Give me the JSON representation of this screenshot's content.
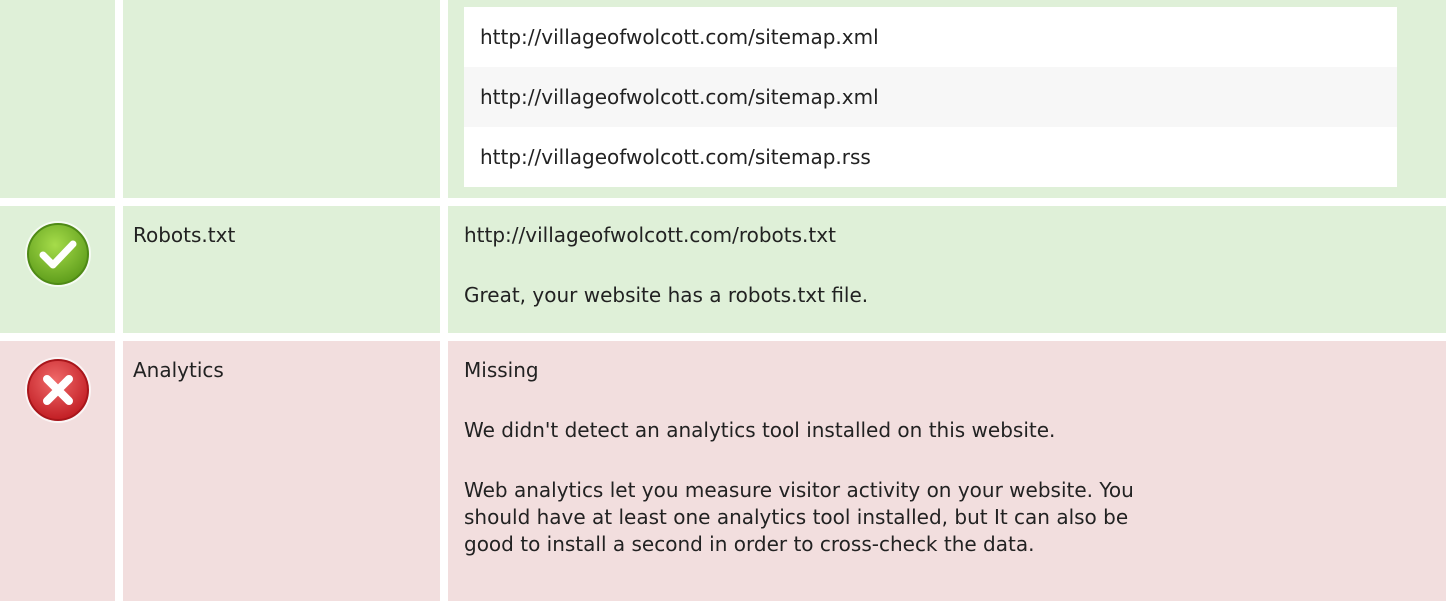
{
  "sitemap": {
    "urls": [
      "http://villageofwolcott.com/sitemap.xml",
      "http://villageofwolcott.com/sitemap.xml",
      "http://villageofwolcott.com/sitemap.rss"
    ]
  },
  "robots": {
    "status_icon": "check-icon",
    "status_color": "#7ab82e",
    "label": "Robots.txt",
    "url": "http://villageofwolcott.com/robots.txt",
    "message": "Great, your website has a robots.txt file."
  },
  "analytics": {
    "status_icon": "cross-icon",
    "status_color": "#e2363b",
    "label": "Analytics",
    "value": "Missing",
    "message": "We didn't detect an analytics tool installed on this website.",
    "advice_line1": "Web analytics let you measure visitor activity on your website. You",
    "advice_line2": "should have at least one analytics tool installed, but It can also be",
    "advice_line3": "good to install a second in order to cross-check the data."
  },
  "colors": {
    "pass_background": "#dff0d8",
    "fail_background": "#f2dede"
  }
}
